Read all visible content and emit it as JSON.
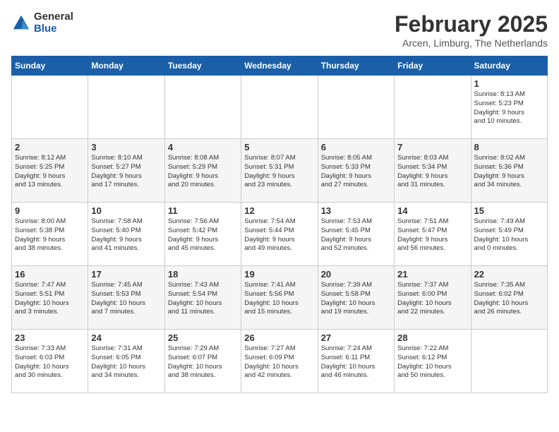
{
  "logo": {
    "general": "General",
    "blue": "Blue"
  },
  "title": "February 2025",
  "location": "Arcen, Limburg, The Netherlands",
  "weekdays": [
    "Sunday",
    "Monday",
    "Tuesday",
    "Wednesday",
    "Thursday",
    "Friday",
    "Saturday"
  ],
  "weeks": [
    [
      {
        "day": "",
        "content": ""
      },
      {
        "day": "",
        "content": ""
      },
      {
        "day": "",
        "content": ""
      },
      {
        "day": "",
        "content": ""
      },
      {
        "day": "",
        "content": ""
      },
      {
        "day": "",
        "content": ""
      },
      {
        "day": "1",
        "content": "Sunrise: 8:13 AM\nSunset: 5:23 PM\nDaylight: 9 hours\nand 10 minutes."
      }
    ],
    [
      {
        "day": "2",
        "content": "Sunrise: 8:12 AM\nSunset: 5:25 PM\nDaylight: 9 hours\nand 13 minutes."
      },
      {
        "day": "3",
        "content": "Sunrise: 8:10 AM\nSunset: 5:27 PM\nDaylight: 9 hours\nand 17 minutes."
      },
      {
        "day": "4",
        "content": "Sunrise: 8:08 AM\nSunset: 5:29 PM\nDaylight: 9 hours\nand 20 minutes."
      },
      {
        "day": "5",
        "content": "Sunrise: 8:07 AM\nSunset: 5:31 PM\nDaylight: 9 hours\nand 23 minutes."
      },
      {
        "day": "6",
        "content": "Sunrise: 8:05 AM\nSunset: 5:33 PM\nDaylight: 9 hours\nand 27 minutes."
      },
      {
        "day": "7",
        "content": "Sunrise: 8:03 AM\nSunset: 5:34 PM\nDaylight: 9 hours\nand 31 minutes."
      },
      {
        "day": "8",
        "content": "Sunrise: 8:02 AM\nSunset: 5:36 PM\nDaylight: 9 hours\nand 34 minutes."
      }
    ],
    [
      {
        "day": "9",
        "content": "Sunrise: 8:00 AM\nSunset: 5:38 PM\nDaylight: 9 hours\nand 38 minutes."
      },
      {
        "day": "10",
        "content": "Sunrise: 7:58 AM\nSunset: 5:40 PM\nDaylight: 9 hours\nand 41 minutes."
      },
      {
        "day": "11",
        "content": "Sunrise: 7:56 AM\nSunset: 5:42 PM\nDaylight: 9 hours\nand 45 minutes."
      },
      {
        "day": "12",
        "content": "Sunrise: 7:54 AM\nSunset: 5:44 PM\nDaylight: 9 hours\nand 49 minutes."
      },
      {
        "day": "13",
        "content": "Sunrise: 7:53 AM\nSunset: 5:45 PM\nDaylight: 9 hours\nand 52 minutes."
      },
      {
        "day": "14",
        "content": "Sunrise: 7:51 AM\nSunset: 5:47 PM\nDaylight: 9 hours\nand 56 minutes."
      },
      {
        "day": "15",
        "content": "Sunrise: 7:49 AM\nSunset: 5:49 PM\nDaylight: 10 hours\nand 0 minutes."
      }
    ],
    [
      {
        "day": "16",
        "content": "Sunrise: 7:47 AM\nSunset: 5:51 PM\nDaylight: 10 hours\nand 3 minutes."
      },
      {
        "day": "17",
        "content": "Sunrise: 7:45 AM\nSunset: 5:53 PM\nDaylight: 10 hours\nand 7 minutes."
      },
      {
        "day": "18",
        "content": "Sunrise: 7:43 AM\nSunset: 5:54 PM\nDaylight: 10 hours\nand 11 minutes."
      },
      {
        "day": "19",
        "content": "Sunrise: 7:41 AM\nSunset: 5:56 PM\nDaylight: 10 hours\nand 15 minutes."
      },
      {
        "day": "20",
        "content": "Sunrise: 7:39 AM\nSunset: 5:58 PM\nDaylight: 10 hours\nand 19 minutes."
      },
      {
        "day": "21",
        "content": "Sunrise: 7:37 AM\nSunset: 6:00 PM\nDaylight: 10 hours\nand 22 minutes."
      },
      {
        "day": "22",
        "content": "Sunrise: 7:35 AM\nSunset: 6:02 PM\nDaylight: 10 hours\nand 26 minutes."
      }
    ],
    [
      {
        "day": "23",
        "content": "Sunrise: 7:33 AM\nSunset: 6:03 PM\nDaylight: 10 hours\nand 30 minutes."
      },
      {
        "day": "24",
        "content": "Sunrise: 7:31 AM\nSunset: 6:05 PM\nDaylight: 10 hours\nand 34 minutes."
      },
      {
        "day": "25",
        "content": "Sunrise: 7:29 AM\nSunset: 6:07 PM\nDaylight: 10 hours\nand 38 minutes."
      },
      {
        "day": "26",
        "content": "Sunrise: 7:27 AM\nSunset: 6:09 PM\nDaylight: 10 hours\nand 42 minutes."
      },
      {
        "day": "27",
        "content": "Sunrise: 7:24 AM\nSunset: 6:11 PM\nDaylight: 10 hours\nand 46 minutes."
      },
      {
        "day": "28",
        "content": "Sunrise: 7:22 AM\nSunset: 6:12 PM\nDaylight: 10 hours\nand 50 minutes."
      },
      {
        "day": "",
        "content": ""
      }
    ]
  ]
}
